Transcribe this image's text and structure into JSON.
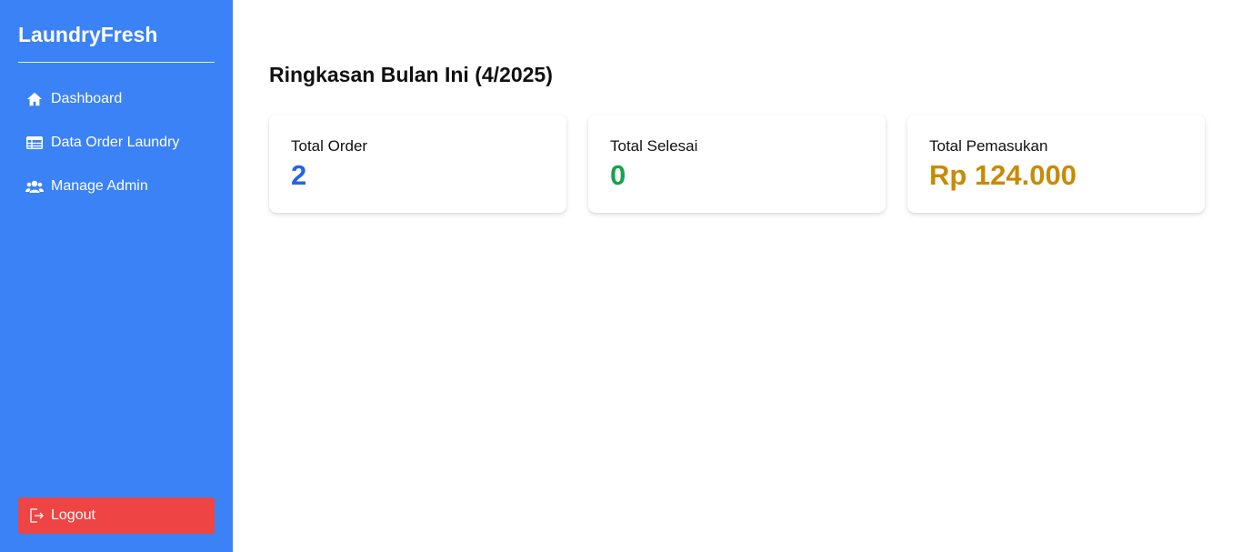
{
  "sidebar": {
    "brand": "LaundryFresh",
    "items": [
      {
        "label": "Dashboard",
        "icon": "home-icon"
      },
      {
        "label": "Data Order Laundry",
        "icon": "table-icon"
      },
      {
        "label": "Manage Admin",
        "icon": "users-icon"
      }
    ],
    "logout_label": "Logout",
    "logout_icon": "logout-icon",
    "color": "#3b82f6",
    "logout_color": "#ef4444"
  },
  "main": {
    "title": "Ringkasan Bulan Ini (4/2025)",
    "cards": [
      {
        "label": "Total Order",
        "value": "2",
        "color": "#2563eb"
      },
      {
        "label": "Total Selesai",
        "value": "0",
        "color": "#16a34a"
      },
      {
        "label": "Total Pemasukan",
        "value": "Rp 124.000",
        "color": "#ca8a04"
      }
    ]
  }
}
